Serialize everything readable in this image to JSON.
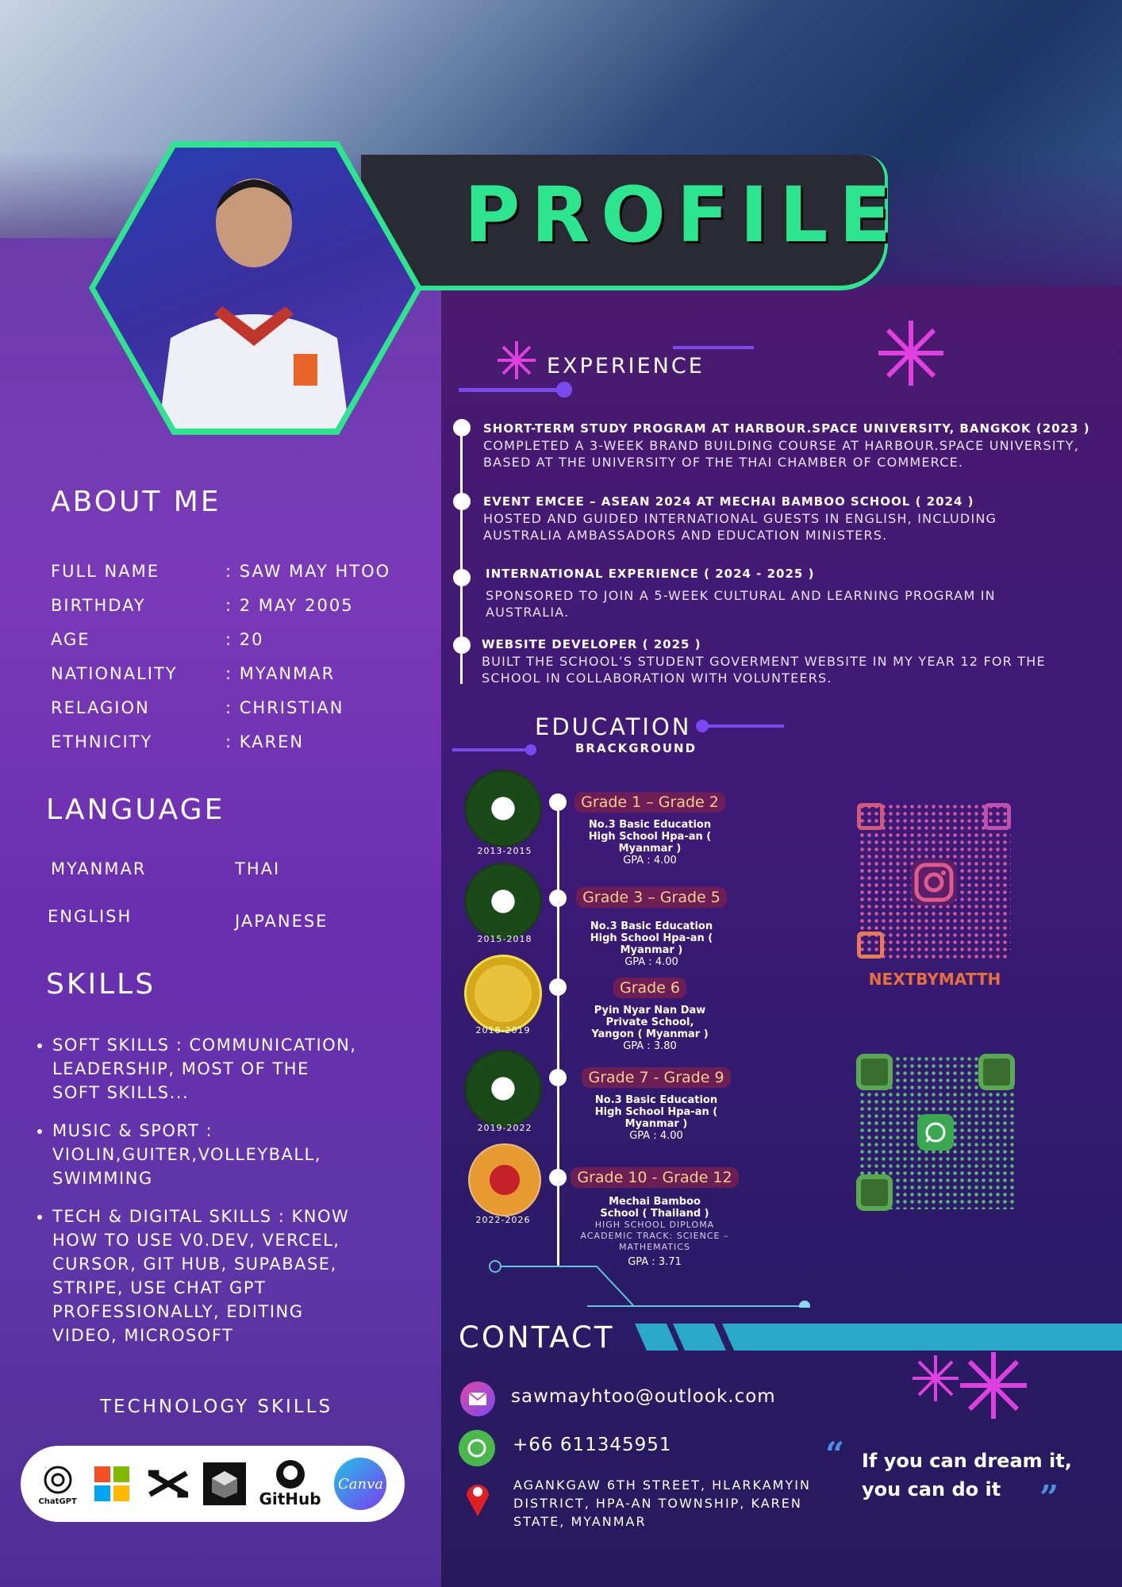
{
  "header": {
    "title": "PROFILE"
  },
  "about": {
    "heading": "ABOUT ME",
    "rows": [
      {
        "label": "FULL NAME",
        "value": ": SAW MAY HTOO"
      },
      {
        "label": "BIRTHDAY",
        "value": ": 2 MAY 2005"
      },
      {
        "label": "AGE",
        "value": ": 20"
      },
      {
        "label": "NATIONALITY",
        "value": ": MYANMAR"
      },
      {
        "label": "RELAGION",
        "value": ": CHRISTIAN"
      },
      {
        "label": "ETHNICITY",
        "value": ": KAREN"
      }
    ]
  },
  "language": {
    "heading": "LANGUAGE",
    "items": [
      "MYANMAR",
      "THAI",
      "ENGLISH",
      "JAPANESE"
    ]
  },
  "skills": {
    "heading": "SKILLS",
    "items": [
      "SOFT SKILLS : COMMUNICATION, LEADERSHIP, MOST OF THE SOFT SKILLS...",
      "MUSIC & SPORT : VIOLIN,GUITER,VOLLEYBALL, SWIMMING",
      "TECH & DIGITAL SKILLS : KNOW HOW TO USE V0.DEV, VERCEL, CURSOR, GIT HUB, SUPABASE, STRIPE, USE CHAT GPT PROFESSIONALLY, EDITING VIDEO, MICROSOFT"
    ]
  },
  "tech": {
    "heading": "TECHNOLOGY SKILLS",
    "chatgpt": "ChatGPT",
    "github": "GitHub",
    "canva": "Canva"
  },
  "experience": {
    "heading": "EXPERIENCE",
    "items": [
      {
        "title": "SHORT-TERM STUDY PROGRAM AT HARBOUR.SPACE UNIVERSITY, BANGKOK  (2023 )",
        "desc": "COMPLETED A 3-WEEK BRAND BUILDING COURSE AT HARBOUR.SPACE UNIVERSITY, BASED AT THE UNIVERSITY OF THE THAI CHAMBER OF COMMERCE."
      },
      {
        "title": "EVENT EMCEE – ASEAN 2024 AT MECHAI BAMBOO SCHOOL ( 2024 )",
        "desc": "HOSTED AND GUIDED INTERNATIONAL GUESTS IN ENGLISH, INCLUDING AUSTRALIA AMBASSADORS AND EDUCATION MINISTERS."
      },
      {
        "title": "INTERNATIONAL EXPERIENCE ( 2024 - 2025 )",
        "desc": "SPONSORED TO JOIN A 5-WEEK CULTURAL AND LEARNING PROGRAM IN AUSTRALIA."
      },
      {
        "title": "WEBSITE DEVELOPER ( 2025 )",
        "desc": "BUILT THE SCHOOL’S STUDENT GOVERMENT WEBSITE IN MY YEAR 12 FOR THE SCHOOL IN COLLABORATION WITH VOLUNTEERS."
      }
    ]
  },
  "education": {
    "heading": "EDUCATION",
    "subheading": "BRACKGROUND",
    "items": [
      {
        "years": "2013-2015",
        "grade": "Grade 1 – Grade 2",
        "school": "No.3 Basic Education High School Hpa-an ( Myanmar )",
        "extra": "",
        "gpa": "GPA : 4.00"
      },
      {
        "years": "2015-2018",
        "grade": "Grade 3 – Grade 5",
        "school": "No.3 Basic Education High School Hpa-an ( Myanmar )",
        "extra": "",
        "gpa": "GPA : 4.00"
      },
      {
        "years": "2018-2019",
        "grade": "Grade 6",
        "school": "Pyin Nyar Nan Daw Private School, Yangon ( Myanmar )",
        "extra": "",
        "gpa": "GPA : 3.80"
      },
      {
        "years": "2019-2022",
        "grade": "Grade 7 - Grade 9",
        "school": "No.3 Basic Education High School Hpa-an ( Myanmar )",
        "extra": "",
        "gpa": "GPA : 4.00"
      },
      {
        "years": "2022-2026",
        "grade": "Grade 10 - Grade 12",
        "school": "Mechai Bamboo School ( Thailand )",
        "extra": "HIGH SCHOOL DIPLOMA ACADEMIC TRACK: SCIENCE – MATHEMATICS",
        "gpa": "GPA : 3.71"
      }
    ]
  },
  "social": {
    "instagram_handle": "NEXTBYMATTH"
  },
  "contact": {
    "heading": "CONTACT",
    "email": "sawmayhtoo@outlook.com",
    "phone": "+66 611345951",
    "address": "AGANKGAW 6TH STREET, HLARKAMYIN DISTRICT, HPA-AN TOWNSHIP, KAREN STATE, MYANMAR"
  },
  "quote": {
    "text": "If you can dream it, you can do it"
  },
  "colors": {
    "accent_green": "#2ee58f",
    "accent_magenta": "#e040e0",
    "teal": "#2aa8c8"
  }
}
